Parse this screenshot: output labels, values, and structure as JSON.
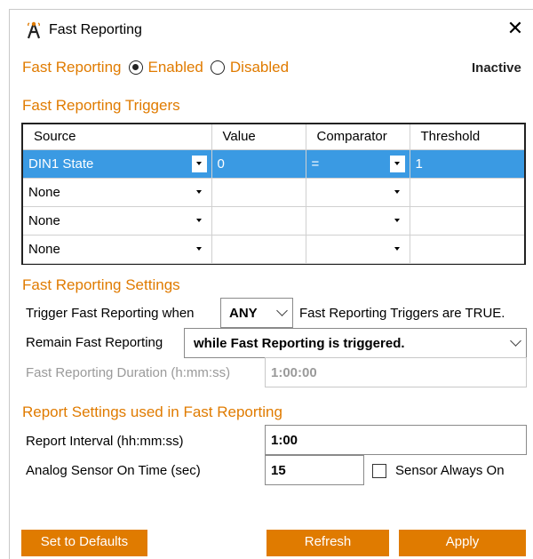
{
  "window": {
    "title": "Fast Reporting",
    "close_glyph": "✕"
  },
  "mode": {
    "label": "Fast Reporting",
    "enabled_label": "Enabled",
    "disabled_label": "Disabled",
    "selected": "Enabled",
    "status": "Inactive"
  },
  "triggers": {
    "section_title": "Fast Reporting Triggers",
    "columns": [
      "Source",
      "Value",
      "Comparator",
      "Threshold"
    ],
    "rows": [
      {
        "source": "DIN1 State",
        "value": "0",
        "comparator": "=",
        "threshold": "1"
      },
      {
        "source": "None",
        "value": "",
        "comparator": "",
        "threshold": ""
      },
      {
        "source": "None",
        "value": "",
        "comparator": "",
        "threshold": ""
      },
      {
        "source": "None",
        "value": "",
        "comparator": "",
        "threshold": ""
      }
    ]
  },
  "settings": {
    "section_title": "Fast Reporting Settings",
    "trigger_when_label": "Trigger Fast Reporting when",
    "trigger_when_value": "ANY",
    "trigger_when_suffix": "Fast Reporting Triggers are TRUE.",
    "remain_label": "Remain Fast Reporting",
    "remain_value": "while Fast Reporting is triggered.",
    "duration_label": "Fast Reporting Duration (h:mm:ss)",
    "duration_value": "1:00:00"
  },
  "report": {
    "section_title": "Report Settings used in Fast Reporting",
    "interval_label": "Report Interval (hh:mm:ss)",
    "interval_value": "1:00",
    "sensor_on_label": "Analog Sensor On Time (sec)",
    "sensor_on_value": "15",
    "sensor_always_on_label": "Sensor Always On",
    "sensor_always_on_checked": false
  },
  "buttons": {
    "defaults": "Set to Defaults",
    "refresh": "Refresh",
    "apply": "Apply"
  },
  "colors": {
    "accent": "#e07b00",
    "selection": "#3a9ae3"
  }
}
